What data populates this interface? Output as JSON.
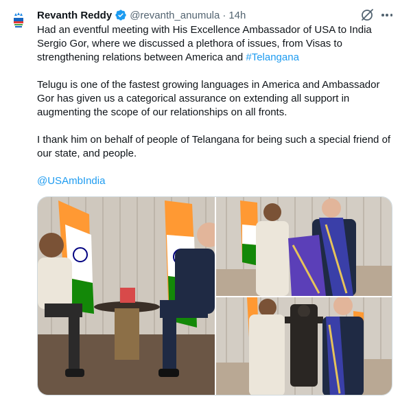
{
  "post": {
    "author_name": "Revanth Reddy",
    "handle": "@revanth_anumula",
    "separator": "·",
    "time": "14h",
    "icons": {
      "verified": "verified-badge-icon",
      "grok": "grok-slash-icon",
      "more": "more-options-icon",
      "avatar": "party-logo-avatar"
    },
    "text_p1_main": "Had an eventful meeting with His Excellence Ambassador of USA to India Sergio Gor, where we discussed a plethora of issues, from Visas to strengthening relations between America and ",
    "hashtag": "#Telangana",
    "text_p2": "Telugu is one of the fastest growing languages in America and Ambassador Gor has given us a categorical assurance on extending all support in augmenting the scope of our relationships on all fronts.",
    "text_p3": "I thank him on behalf of people of Telangana for being such a special friend of our state, and people.",
    "mention": "@USAmbIndia"
  },
  "colors": {
    "text": "#0f1419",
    "secondary": "#536471",
    "link": "#1d9bf0",
    "verified": "#1d9bf0"
  }
}
